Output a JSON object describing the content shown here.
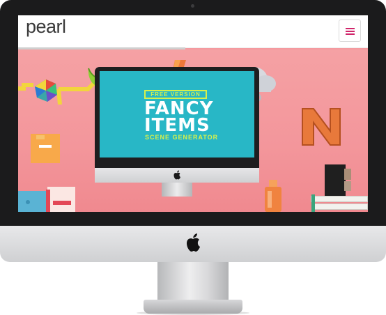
{
  "site": {
    "logo": "pearl",
    "menu_icon": "hamburger-icon",
    "accent_color": "#d0256a"
  },
  "hero": {
    "background_color": "#f49a9f",
    "poster": {
      "badge": "FREE VERSION",
      "title_line1": "FANCY",
      "title_line2": "ITEMS",
      "subtitle": "SCENE GENERATOR",
      "screen_color": "#28b7c6",
      "accent_color": "#d6f04c"
    },
    "props": [
      "gem-icon",
      "banana-icon",
      "lightning-icon",
      "cloud-icon",
      "n-letter-icon",
      "sticky-note-icon",
      "bottle-icon",
      "speaker-icon",
      "books-icon",
      "notes-icon"
    ]
  },
  "device": {
    "logo_icon": "apple-logo-icon"
  }
}
